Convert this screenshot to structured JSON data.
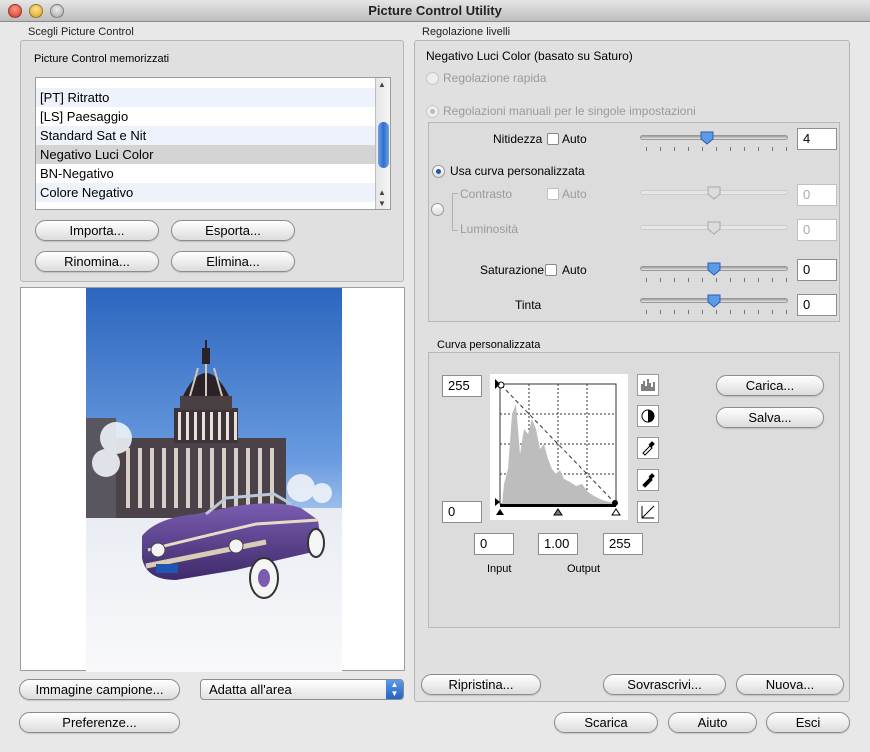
{
  "window": {
    "title": "Picture Control Utility"
  },
  "left": {
    "group_label": "Scegli Picture Control",
    "stored_label": "Picture Control memorizzati",
    "list": [
      {
        "label": "[PT] Ritratto"
      },
      {
        "label": "[LS] Paesaggio"
      },
      {
        "label": "Standard Sat e Nit"
      },
      {
        "label": "Negativo Luci Color"
      },
      {
        "label": "BN-Negativo"
      },
      {
        "label": "Colore Negativo"
      }
    ],
    "selected_item": "Negativo Luci Color",
    "buttons": {
      "import": "Importa...",
      "export": "Esporta...",
      "rename": "Rinomina...",
      "delete": "Elimina..."
    },
    "sample_image_button": "Immagine campione...",
    "fit_select": "Adatta all'area",
    "prefs_button": "Preferenze..."
  },
  "right": {
    "group_label": "Regolazione livelli",
    "heading": "Negativo Luci Color (basato su Saturo)",
    "quick_adjust": "Regolazione rapida",
    "manual_adjust": "Regolazioni manuali per le singole impostazioni",
    "sharpness": {
      "label": "Nitidezza",
      "auto": "Auto",
      "value": "4",
      "level": 0.45
    },
    "use_custom_curve": "Usa curva personalizzata",
    "contrast": {
      "label": "Contrasto",
      "auto": "Auto",
      "value": "0",
      "level": 0.5
    },
    "brightness": {
      "label": "Luminosità",
      "value": "0",
      "level": 0.5
    },
    "saturation": {
      "label": "Saturazione",
      "auto": "Auto",
      "value": "0",
      "level": 0.5
    },
    "hue": {
      "label": "Tinta",
      "value": "0",
      "level": 0.5
    },
    "curve": {
      "label": "Curva personalizzata",
      "top_value": "255",
      "bottom_value": "0",
      "input_value": "0",
      "gamma_value": "1.00",
      "output_value": "255",
      "input_label": "Input",
      "output_label": "Output",
      "load_button": "Carica...",
      "save_button": "Salva..."
    },
    "reset_button": "Ripristina...",
    "overwrite_button": "Sovrascrivi...",
    "new_button": "Nuova..."
  },
  "footer": {
    "download_button": "Scarica",
    "help_button": "Aiuto",
    "exit_button": "Esci"
  },
  "colors": {
    "accent": "#2e6fd0",
    "sky": "#2f6fc4",
    "car": "#5b3f8e"
  }
}
